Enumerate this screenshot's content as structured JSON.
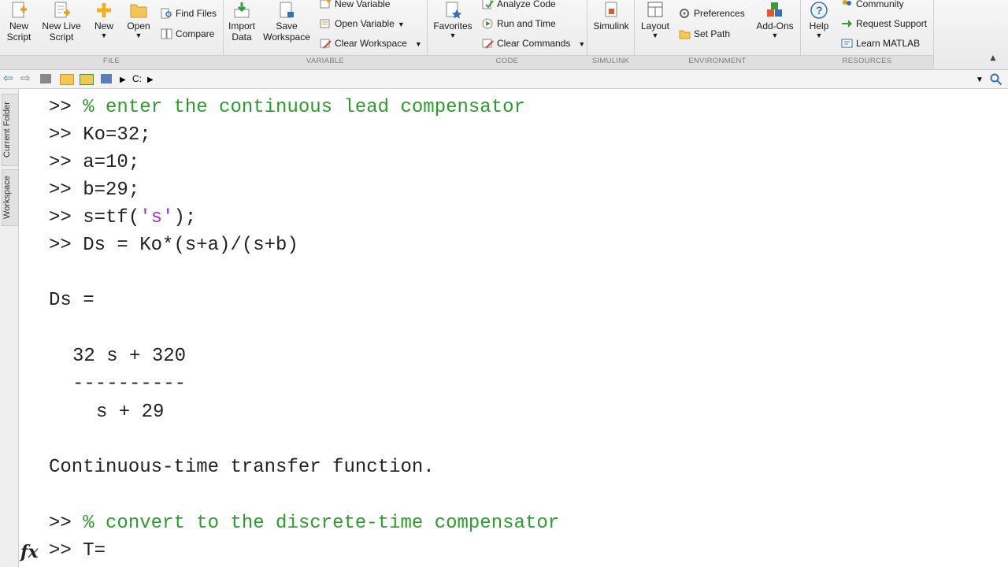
{
  "ribbon": {
    "file": {
      "new_script": "New Script",
      "new_live_script": "New Live Script",
      "new": "New",
      "open": "Open",
      "find_files": "Find Files",
      "compare": "Compare",
      "label": "FILE"
    },
    "variable": {
      "import_data": "Import Data",
      "save_workspace": "Save Workspace",
      "new_variable": "New Variable",
      "open_variable": "Open Variable",
      "clear_workspace": "Clear Workspace",
      "label": "VARIABLE"
    },
    "code": {
      "favorites": "Favorites",
      "analyze_code": "Analyze Code",
      "run_and_time": "Run and Time",
      "clear_commands": "Clear Commands",
      "label": "CODE"
    },
    "simulink": {
      "simulink": "Simulink",
      "label": "SIMULINK"
    },
    "environment": {
      "layout": "Layout",
      "preferences": "Preferences",
      "set_path": "Set Path",
      "add_ons": "Add-Ons",
      "label": "ENVIRONMENT"
    },
    "resources": {
      "help": "Help",
      "community": "Community",
      "request_support": "Request Support",
      "learn_matlab": "Learn MATLAB",
      "label": "RESOURCES"
    }
  },
  "address": {
    "path": "C:"
  },
  "sidebar": {
    "current_folder": "Current Folder",
    "workspace": "Workspace"
  },
  "command_window": {
    "prompt": ">>",
    "l1": "% enter the continuous lead compensator",
    "l2": "Ko=32;",
    "l3": "a=10;",
    "l4": "b=29;",
    "l5a": "s=tf(",
    "l5s": "'s'",
    "l5b": ");",
    "l6": "Ds = Ko*(s+a)/(s+b)",
    "o1": "Ds =",
    "o2": "32 s + 320",
    "o3": "----------",
    "o4": "s + 29",
    "o5": "Continuous-time transfer function.",
    "l7": "% convert to the discrete-time compensator",
    "l8": "T="
  },
  "fx_label": "fx",
  "colors": {
    "comment": "#2e9b2e",
    "string": "#a431c9"
  }
}
